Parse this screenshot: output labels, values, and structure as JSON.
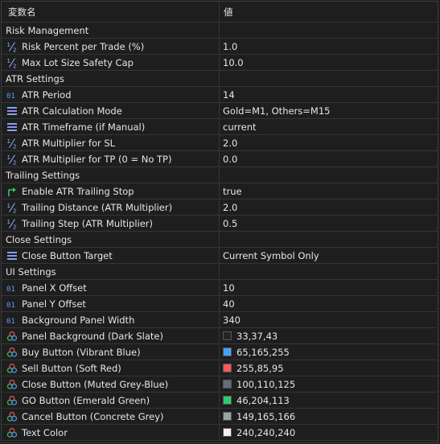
{
  "header": {
    "name_col": "変数名",
    "value_col": "値"
  },
  "rows": [
    {
      "kind": "section",
      "label": "Risk Management"
    },
    {
      "kind": "param",
      "icon": "fraction-icon",
      "label": "Risk Percent per Trade (%)",
      "value": "1.0"
    },
    {
      "kind": "param",
      "icon": "fraction-icon",
      "label": "Max Lot Size Safety Cap",
      "value": "10.0"
    },
    {
      "kind": "section",
      "label": "ATR Settings"
    },
    {
      "kind": "param",
      "icon": "integer-icon",
      "label": "ATR Period",
      "value": "14"
    },
    {
      "kind": "param",
      "icon": "enum-list-icon",
      "label": "ATR Calculation Mode",
      "value": "Gold=M1, Others=M15"
    },
    {
      "kind": "param",
      "icon": "enum-list-icon",
      "label": "ATR Timeframe (if Manual)",
      "value": "current"
    },
    {
      "kind": "param",
      "icon": "fraction-icon",
      "label": "ATR Multiplier for SL",
      "value": "2.0"
    },
    {
      "kind": "param",
      "icon": "fraction-icon",
      "label": "ATR Multiplier for TP (0 = No TP)",
      "value": "0.0"
    },
    {
      "kind": "section",
      "label": "Trailing Settings"
    },
    {
      "kind": "param",
      "icon": "bool-arrow-icon",
      "label": "Enable ATR Trailing Stop",
      "value": "true"
    },
    {
      "kind": "param",
      "icon": "fraction-icon",
      "label": "Trailing Distance (ATR Multiplier)",
      "value": "2.0"
    },
    {
      "kind": "param",
      "icon": "fraction-icon",
      "label": "Trailing Step (ATR Multiplier)",
      "value": "0.5"
    },
    {
      "kind": "section",
      "label": "Close Settings"
    },
    {
      "kind": "param",
      "icon": "enum-list-icon",
      "label": "Close Button Target",
      "value": "Current Symbol Only"
    },
    {
      "kind": "section",
      "label": "UI Settings"
    },
    {
      "kind": "param",
      "icon": "integer-icon",
      "label": "Panel X Offset",
      "value": "10"
    },
    {
      "kind": "param",
      "icon": "integer-icon",
      "label": "Panel Y Offset",
      "value": "40"
    },
    {
      "kind": "param",
      "icon": "integer-icon",
      "label": "Background Panel Width",
      "value": "340"
    },
    {
      "kind": "param",
      "icon": "color-palette-icon",
      "label": "Panel Background (Dark Slate)",
      "value": "33,37,43",
      "swatch": "#21252b"
    },
    {
      "kind": "param",
      "icon": "color-palette-icon",
      "label": "Buy Button (Vibrant Blue)",
      "value": "65,165,255",
      "swatch": "#41a5ff"
    },
    {
      "kind": "param",
      "icon": "color-palette-icon",
      "label": "Sell Button (Soft Red)",
      "value": "255,85,95",
      "swatch": "#ff555f"
    },
    {
      "kind": "param",
      "icon": "color-palette-icon",
      "label": "Close Button (Muted Grey-Blue)",
      "value": "100,110,125",
      "swatch": "#646e7d"
    },
    {
      "kind": "param",
      "icon": "color-palette-icon",
      "label": "GO Button (Emerald Green)",
      "value": "46,204,113",
      "swatch": "#2ecc71"
    },
    {
      "kind": "param",
      "icon": "color-palette-icon",
      "label": "Cancel Button (Concrete Grey)",
      "value": "149,165,166",
      "swatch": "#95a5a6"
    },
    {
      "kind": "param",
      "icon": "color-palette-icon",
      "label": "Text Color",
      "value": "240,240,240",
      "swatch": "#f0f0f0"
    }
  ]
}
